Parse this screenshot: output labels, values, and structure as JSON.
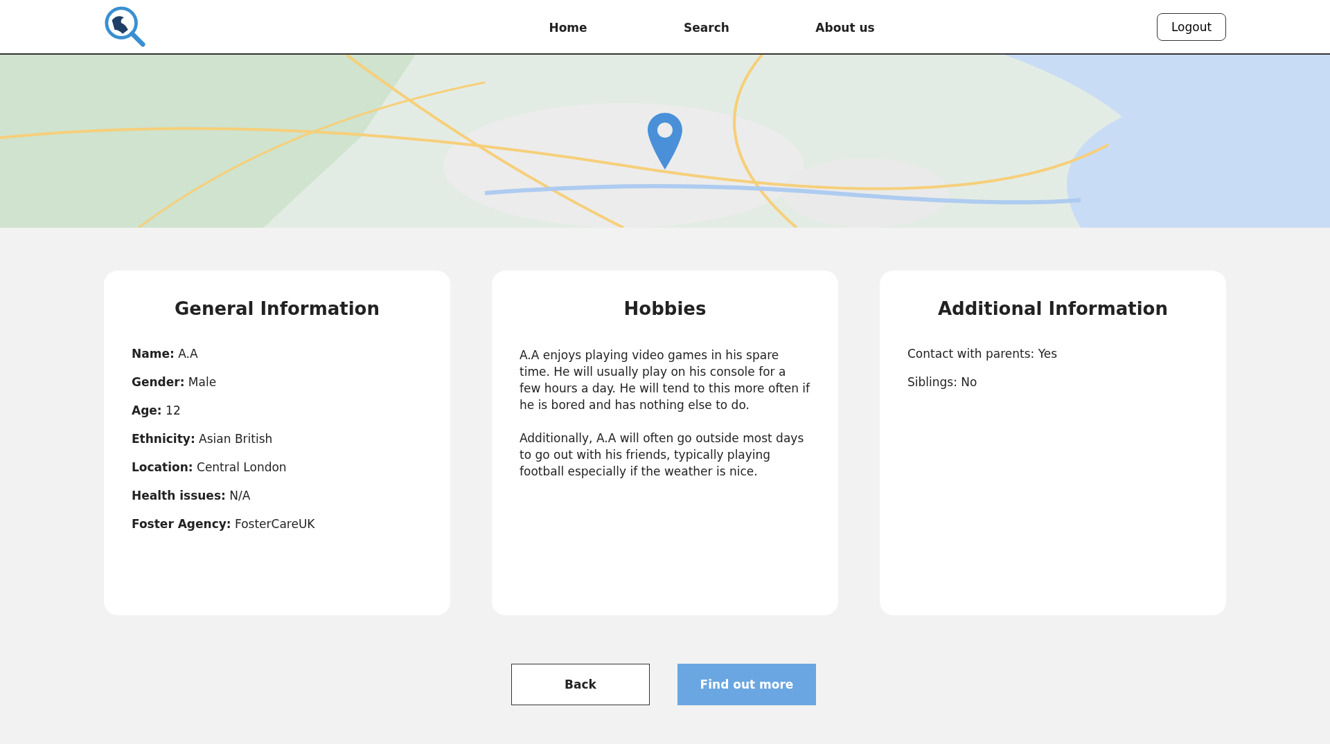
{
  "nav": {
    "links": [
      "Home",
      "Search",
      "About us"
    ],
    "logout": "Logout"
  },
  "cards": [
    {
      "title": "General Information",
      "kind": "fields",
      "fields": [
        {
          "label": "Name:",
          "value": "A.A"
        },
        {
          "label": "Gender:",
          "value": "Male"
        },
        {
          "label": "Age:",
          "value": "12"
        },
        {
          "label": "Ethnicity:",
          "value": "Asian British"
        },
        {
          "label": "Location:",
          "value": "Central London"
        },
        {
          "label": "Health issues:",
          "value": "N/A"
        },
        {
          "label": "Foster Agency:",
          "value": "FosterCareUK"
        }
      ]
    },
    {
      "title": "Hobbies",
      "kind": "paragraphs",
      "paragraphs": [
        "A.A enjoys playing video games in his spare time. He will usually play on his console for a few hours a day. He will tend to this more often if he is bored and has nothing else to do.",
        "Additionally, A.A will often go outside most days to go out with his friends, typically playing football especially if the weather is nice."
      ]
    },
    {
      "title": "Additional Information",
      "kind": "lines",
      "lines": [
        "Contact with parents: Yes",
        "Siblings: No"
      ]
    }
  ],
  "buttons": {
    "back": "Back",
    "more": "Find out more"
  }
}
